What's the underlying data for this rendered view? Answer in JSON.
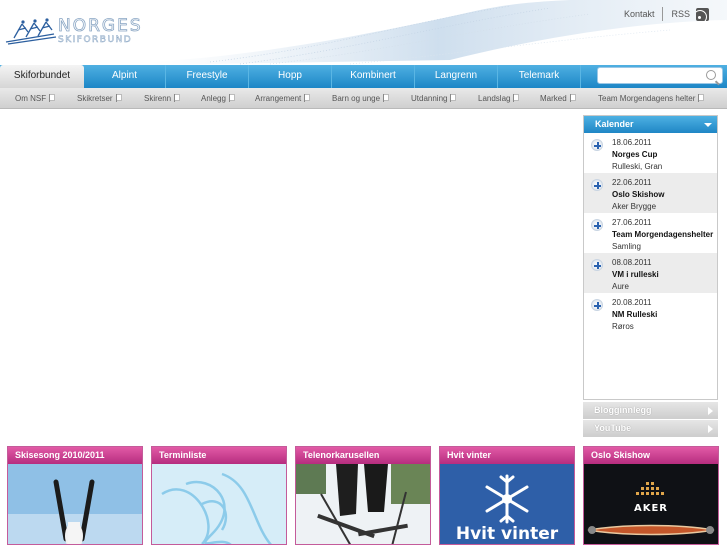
{
  "header": {
    "logo_line1": "NORGES",
    "logo_line2": "SKIFORBUND",
    "links": [
      "Kontakt",
      "RSS"
    ]
  },
  "main_nav": {
    "tabs": [
      "Skiforbundet",
      "Alpint",
      "Freestyle",
      "Hopp",
      "Kombinert",
      "Langrenn",
      "Telemark"
    ],
    "active": "Skiforbundet",
    "search_placeholder": ""
  },
  "sub_nav": {
    "items": [
      "Om NSF",
      "Skikretser",
      "Skirenn",
      "Anlegg",
      "Arrangement",
      "Barn og unge",
      "Utdanning",
      "Landslag",
      "Marked",
      "Team Morgendagens helter"
    ]
  },
  "calendar": {
    "title": "Kalender",
    "events": [
      {
        "date": "18.06.2011",
        "title": "Norges Cup",
        "place": "Rulleski, Gran"
      },
      {
        "date": "22.06.2011",
        "title": "Oslo Skishow",
        "place": "Aker Brygge"
      },
      {
        "date": "27.06.2011",
        "title": "Team Morgendagenshelter",
        "place": "Samling"
      },
      {
        "date": "08.08.2011",
        "title": "VM i rulleski",
        "place": "Aure"
      },
      {
        "date": "20.08.2011",
        "title": "NM Rulleski",
        "place": "Røros"
      }
    ]
  },
  "side_boxes": [
    "Blogginnlegg",
    "YouTube"
  ],
  "feature_boxes": [
    {
      "title": "Skisesong 2010/2011"
    },
    {
      "title": "Terminliste"
    },
    {
      "title": "Telenorkarusellen"
    },
    {
      "title": "Hvit vinter",
      "image_text": "Hvit vinter"
    },
    {
      "title": "Oslo Skishow",
      "image_text": "AKER"
    }
  ],
  "colors": {
    "nav_blue": "#1c86c6",
    "box_magenta": "#b62d7f",
    "hvit_vinter_blue": "#2e5fa8"
  }
}
